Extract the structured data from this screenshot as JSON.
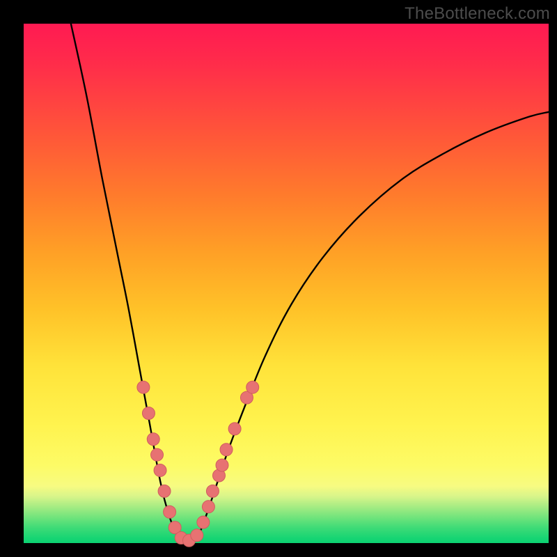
{
  "watermark": "TheBottleneck.com",
  "colors": {
    "frame": "#000000",
    "curve": "#000000",
    "dot_fill": "#e77272",
    "dot_stroke": "#cf5e5e"
  },
  "chart_data": {
    "type": "line",
    "title": "",
    "xlabel": "",
    "ylabel": "",
    "xlim": [
      0,
      100
    ],
    "ylim": [
      0,
      100
    ],
    "curve": [
      {
        "x": 9,
        "y": 100
      },
      {
        "x": 12,
        "y": 86
      },
      {
        "x": 15,
        "y": 70
      },
      {
        "x": 18,
        "y": 55
      },
      {
        "x": 20,
        "y": 45
      },
      {
        "x": 22,
        "y": 34
      },
      {
        "x": 24,
        "y": 23
      },
      {
        "x": 26,
        "y": 12
      },
      {
        "x": 27.5,
        "y": 6
      },
      {
        "x": 29,
        "y": 2
      },
      {
        "x": 30.5,
        "y": 0.5
      },
      {
        "x": 32,
        "y": 0.5
      },
      {
        "x": 33.5,
        "y": 2
      },
      {
        "x": 35,
        "y": 6
      },
      {
        "x": 37,
        "y": 12
      },
      {
        "x": 39,
        "y": 18
      },
      {
        "x": 42,
        "y": 26
      },
      {
        "x": 46,
        "y": 36
      },
      {
        "x": 51,
        "y": 46
      },
      {
        "x": 57,
        "y": 55
      },
      {
        "x": 64,
        "y": 63
      },
      {
        "x": 72,
        "y": 70
      },
      {
        "x": 80,
        "y": 75
      },
      {
        "x": 88,
        "y": 79
      },
      {
        "x": 96,
        "y": 82
      },
      {
        "x": 100,
        "y": 83
      }
    ],
    "dots": [
      {
        "x": 22.8,
        "y": 30
      },
      {
        "x": 23.8,
        "y": 25
      },
      {
        "x": 24.7,
        "y": 20
      },
      {
        "x": 25.4,
        "y": 17
      },
      {
        "x": 26.0,
        "y": 14
      },
      {
        "x": 26.8,
        "y": 10
      },
      {
        "x": 27.8,
        "y": 6
      },
      {
        "x": 28.8,
        "y": 3
      },
      {
        "x": 30.0,
        "y": 1
      },
      {
        "x": 31.5,
        "y": 0.5
      },
      {
        "x": 33.0,
        "y": 1.5
      },
      {
        "x": 34.2,
        "y": 4
      },
      {
        "x": 35.2,
        "y": 7
      },
      {
        "x": 36.0,
        "y": 10
      },
      {
        "x": 37.2,
        "y": 13
      },
      {
        "x": 37.8,
        "y": 15
      },
      {
        "x": 38.6,
        "y": 18
      },
      {
        "x": 40.2,
        "y": 22
      },
      {
        "x": 42.5,
        "y": 28
      },
      {
        "x": 43.6,
        "y": 30
      }
    ]
  }
}
